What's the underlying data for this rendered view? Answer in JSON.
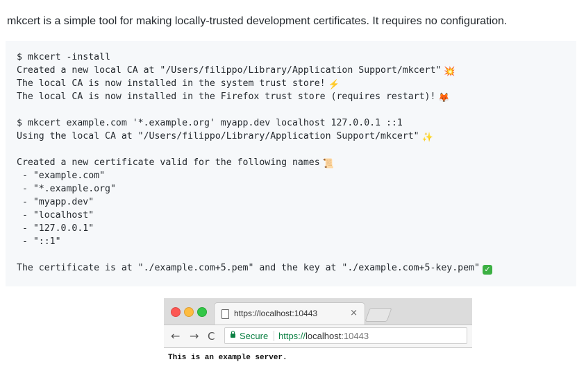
{
  "intro": "mkcert is a simple tool for making locally-trusted development certificates. It requires no configuration.",
  "code": {
    "lines": [
      "$ mkcert -install",
      "Created a new local CA at \"/Users/filippo/Library/Application Support/mkcert\"",
      "The local CA is now installed in the system trust store!",
      "The local CA is now installed in the Firefox trust store (requires restart)!",
      "",
      "$ mkcert example.com '*.example.org' myapp.dev localhost 127.0.0.1 ::1",
      "Using the local CA at \"/Users/filippo/Library/Application Support/mkcert\"",
      "",
      "Created a new certificate valid for the following names",
      " - \"example.com\"",
      " - \"*.example.org\"",
      " - \"myapp.dev\"",
      " - \"localhost\"",
      " - \"127.0.0.1\"",
      " - \"::1\"",
      "",
      "The certificate is at \"./example.com+5.pem\" and the key at \"./example.com+5-key.pem\""
    ],
    "emojis": {
      "line1": "💥",
      "line2": "⚡️",
      "line3": "🦊",
      "line6": "✨",
      "line8": "📜",
      "line16": "✓"
    }
  },
  "browser": {
    "tab_title": "https://localhost:10443",
    "tab_close": "×",
    "nav_back": "←",
    "nav_forward": "→",
    "nav_reload": "C",
    "secure_label": "Secure",
    "url_scheme": "https://",
    "url_host": "localhost",
    "url_port": ":10443",
    "page_text": "This is an example server."
  },
  "colors": {
    "code_bg": "#f6f8fa",
    "secure_green": "#0b8043"
  }
}
